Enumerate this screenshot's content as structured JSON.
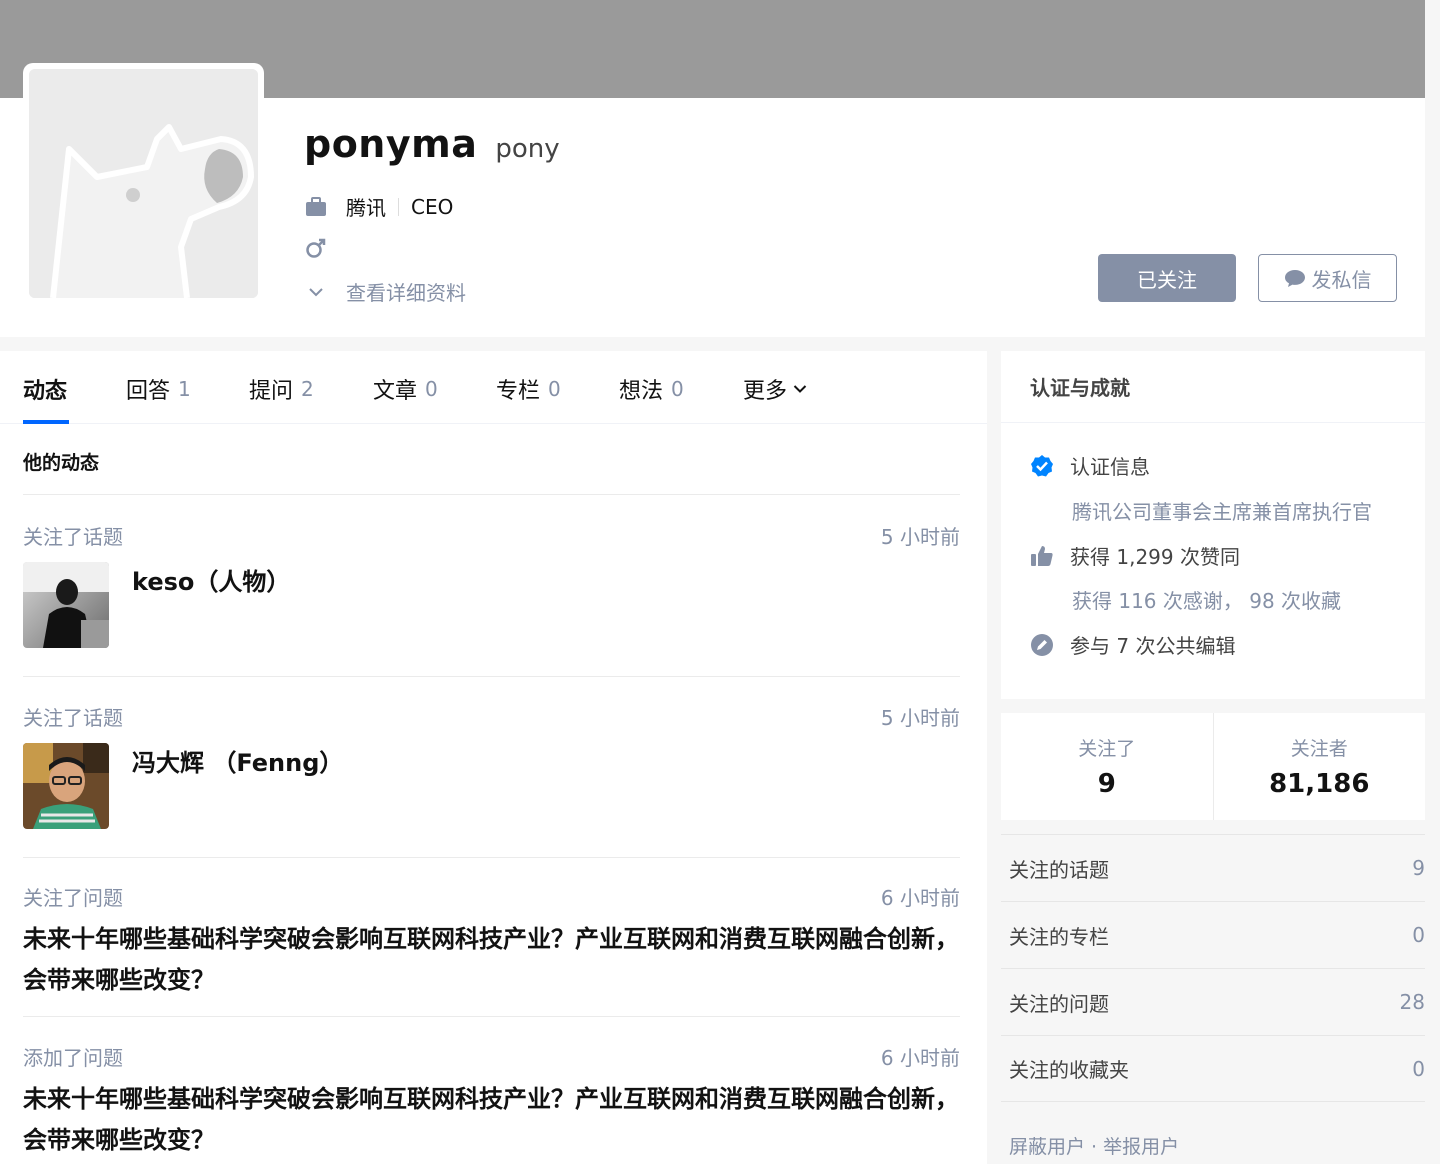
{
  "profile": {
    "name": "ponyma",
    "headline": "pony",
    "company": "腾讯",
    "position": "CEO",
    "detail_link": "查看详细资料",
    "follow_button": "已关注",
    "message_button": "发私信"
  },
  "tabs": [
    {
      "label": "动态",
      "count": ""
    },
    {
      "label": "回答",
      "count": "1"
    },
    {
      "label": "提问",
      "count": "2"
    },
    {
      "label": "文章",
      "count": "0"
    },
    {
      "label": "专栏",
      "count": "0"
    },
    {
      "label": "想法",
      "count": "0"
    },
    {
      "label": "更多",
      "count": ""
    }
  ],
  "feed": {
    "title": "他的动态",
    "items": [
      {
        "action": "关注了话题",
        "time": "5 小时前",
        "topic": "keso（人物）"
      },
      {
        "action": "关注了话题",
        "time": "5 小时前",
        "topic": "冯大辉 （Fenng）"
      },
      {
        "action": "关注了问题",
        "time": "6 小时前",
        "question": "未来十年哪些基础科学突破会影响互联网科技产业？产业互联网和消费互联网融合创新，会带来哪些改变？"
      },
      {
        "action": "添加了问题",
        "time": "6 小时前",
        "question": "未来十年哪些基础科学突破会影响互联网科技产业？产业互联网和消费互联网融合创新，会带来哪些改变？"
      }
    ]
  },
  "achievements": {
    "title": "认证与成就",
    "verify_label": "认证信息",
    "verify_detail": "腾讯公司董事会主席兼首席执行官",
    "likes": "获得 1,299 次赞同",
    "thanks": "获得 116 次感谢，  98 次收藏",
    "edits": "参与 7 次公共编辑"
  },
  "stats": {
    "following_label": "关注了",
    "following": "9",
    "followers_label": "关注者",
    "followers": "81,186"
  },
  "side_list": [
    {
      "label": "关注的话题",
      "count": "9"
    },
    {
      "label": "关注的专栏",
      "count": "0"
    },
    {
      "label": "关注的问题",
      "count": "28"
    },
    {
      "label": "关注的收藏夹",
      "count": "0"
    }
  ],
  "footer": {
    "block": "屏蔽用户",
    "dot": " · ",
    "report": "举报用户"
  },
  "colors": {
    "accent": "#0066ff",
    "muted": "#8590a6",
    "verified": "#0084ff"
  }
}
